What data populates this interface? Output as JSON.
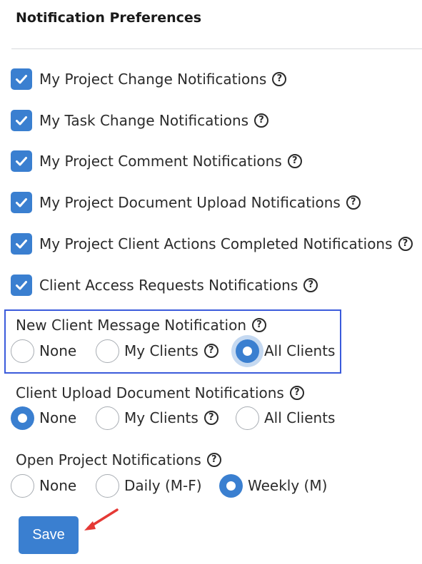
{
  "panel": {
    "title": "Notification Preferences"
  },
  "checkboxes": [
    {
      "label": "My Project Change Notifications",
      "checked": true
    },
    {
      "label": "My Task Change Notifications",
      "checked": true
    },
    {
      "label": "My Project Comment Notifications",
      "checked": true
    },
    {
      "label": "My Project Document Upload Notifications",
      "checked": true
    },
    {
      "label": "My Project Client Actions Completed Notifications",
      "checked": true
    },
    {
      "label": "Client Access Requests Notifications",
      "checked": true
    }
  ],
  "help_glyph": "?",
  "radio_groups": {
    "new_client_message": {
      "label": "New Client Message Notification",
      "options": [
        "None",
        "My Clients",
        "All Clients"
      ],
      "selected": "All Clients"
    },
    "client_upload_document": {
      "label": "Client Upload Document Notifications",
      "options": [
        "None",
        "My Clients",
        "All Clients"
      ],
      "selected": "None"
    },
    "open_project": {
      "label": "Open Project Notifications",
      "options": [
        "None",
        "Daily (M-F)",
        "Weekly (M)"
      ],
      "selected": "Weekly (M)"
    }
  },
  "actions": {
    "save_label": "Save"
  },
  "colors": {
    "accent": "#3a7fd0",
    "highlight_border": "#3b5bdb",
    "annotation_arrow": "#e53935"
  }
}
